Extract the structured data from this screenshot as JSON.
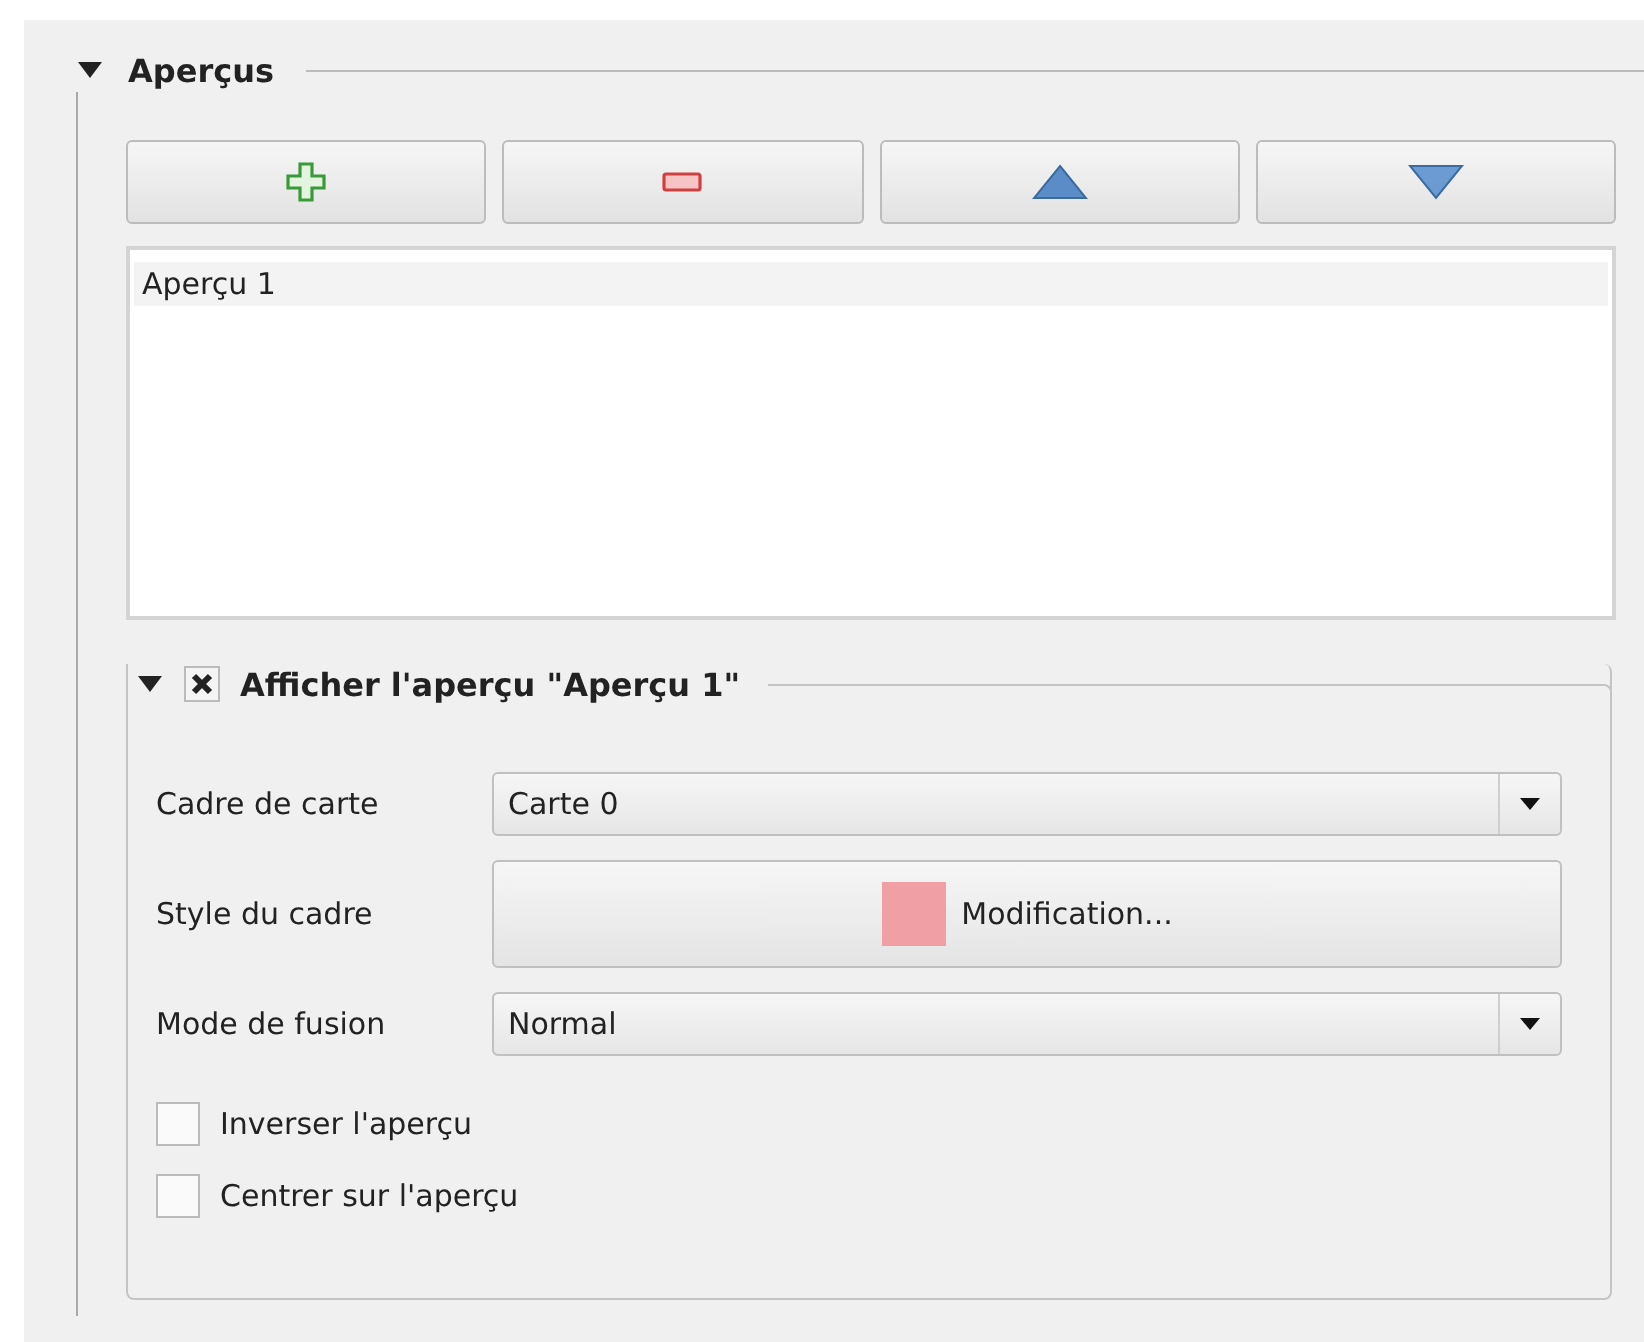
{
  "section": {
    "title": "Aperçus",
    "expanded": true
  },
  "toolbar": [
    {
      "kind": "add"
    },
    {
      "kind": "remove"
    },
    {
      "kind": "up"
    },
    {
      "kind": "down"
    }
  ],
  "list": [
    {
      "label": "Aperçu 1",
      "selected": true
    }
  ],
  "group": {
    "title": "Afficher l'aperçu \"Aperçu 1\"",
    "checked": true,
    "expanded": true,
    "fields": [
      {
        "kind": "combo",
        "label": "Cadre de carte",
        "value": "Carte 0"
      },
      {
        "kind": "style",
        "label": "Style du cadre",
        "value": "Modification...",
        "color": "#f0a0a4"
      },
      {
        "kind": "combo",
        "label": "Mode de fusion",
        "value": "Normal"
      }
    ],
    "checkboxes": [
      {
        "label": "Inverser l'aperçu",
        "checked": false
      },
      {
        "label": "Centrer sur l'aperçu",
        "checked": false
      }
    ]
  }
}
